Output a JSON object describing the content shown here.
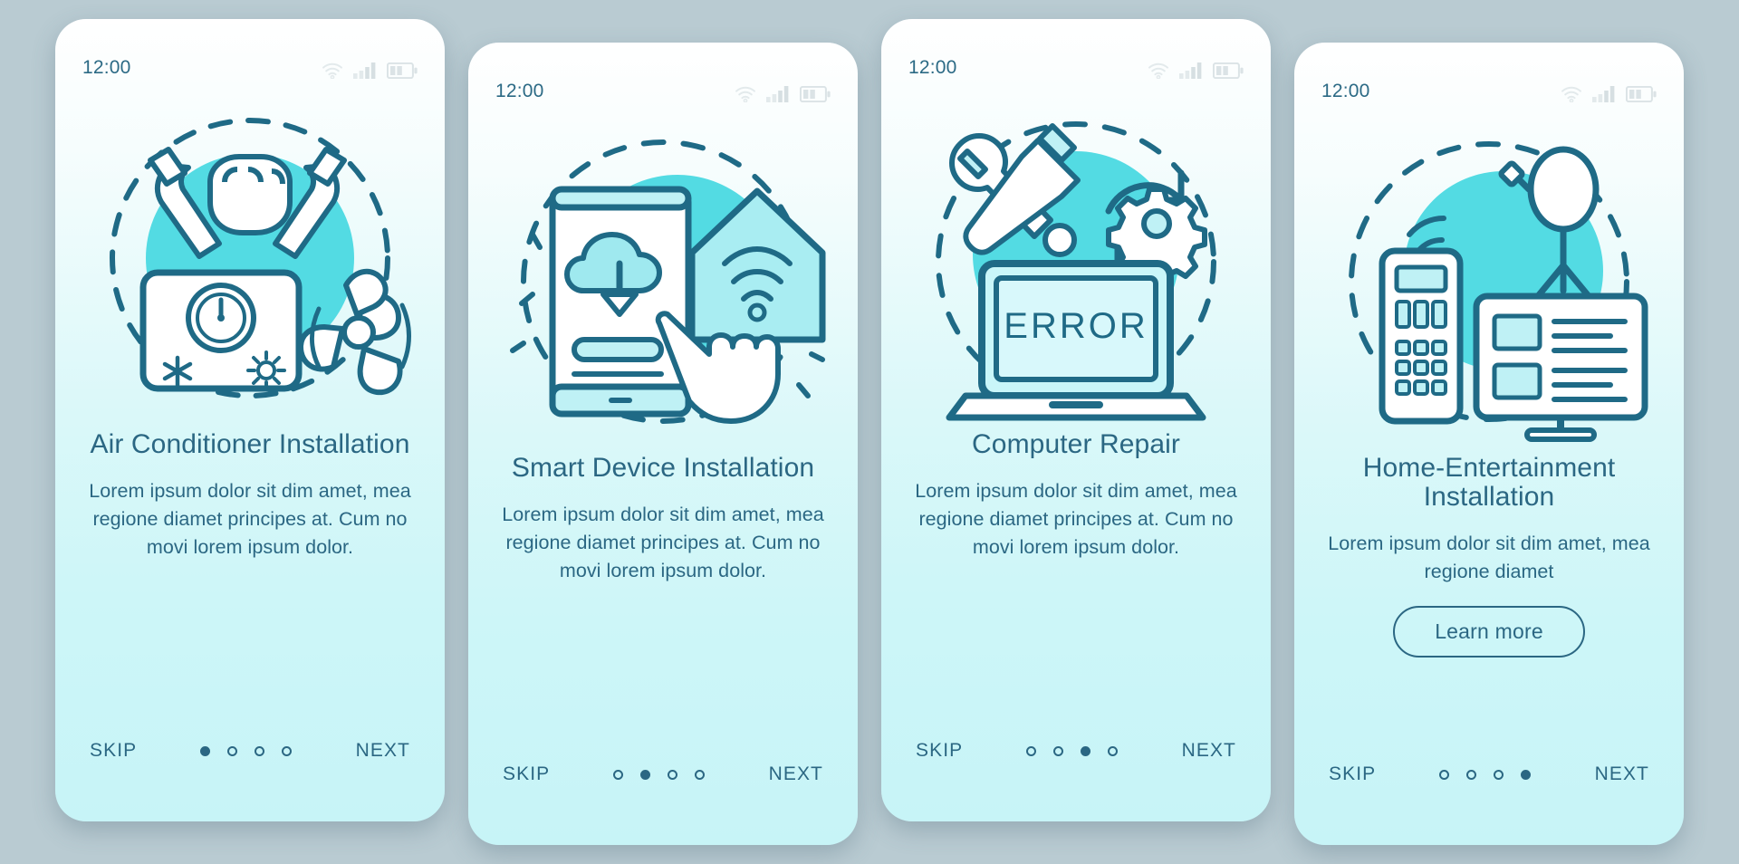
{
  "theme": {
    "page_background": "#b9cbd2",
    "ink": "#2b6783",
    "accent_teal": "#4bd6e0",
    "card_top": "#ffffff",
    "card_bottom": "#c7f4f7"
  },
  "screens": [
    {
      "status": {
        "time": "12:00",
        "wifi_icon": "wifi-icon",
        "signal_icon": "signal-bars-icon",
        "battery_icon": "battery-icon"
      },
      "illustration": "air-conditioner-illustration",
      "title": "Air Conditioner Installation",
      "description": "Lorem ipsum dolor sit dim amet, mea regione diamet principes at. Cum no movi lorem ipsum dolor.",
      "cta": null,
      "skip_label": "SKIP",
      "next_label": "NEXT",
      "dots": 4,
      "active_dot": 0
    },
    {
      "status": {
        "time": "12:00",
        "wifi_icon": "wifi-icon",
        "signal_icon": "signal-bars-icon",
        "battery_icon": "battery-icon"
      },
      "illustration": "smart-device-illustration",
      "title": "Smart Device Installation",
      "description": "Lorem ipsum dolor sit dim amet, mea regione diamet principes at. Cum no movi lorem ipsum dolor.",
      "cta": null,
      "skip_label": "SKIP",
      "next_label": "NEXT",
      "dots": 4,
      "active_dot": 1
    },
    {
      "status": {
        "time": "12:00",
        "wifi_icon": "wifi-icon",
        "signal_icon": "signal-bars-icon",
        "battery_icon": "battery-icon"
      },
      "illustration": "computer-repair-illustration",
      "screen_text": "ERROR",
      "title": "Computer Repair",
      "description": "Lorem ipsum dolor sit dim amet, mea regione diamet principes at. Cum no movi lorem ipsum dolor.",
      "cta": null,
      "skip_label": "SKIP",
      "next_label": "NEXT",
      "dots": 4,
      "active_dot": 2
    },
    {
      "status": {
        "time": "12:00",
        "wifi_icon": "wifi-icon",
        "signal_icon": "signal-bars-icon",
        "battery_icon": "battery-icon"
      },
      "illustration": "home-entertainment-illustration",
      "title": "Home-Entertainment Installation",
      "description": "Lorem ipsum dolor sit dim amet, mea regione diamet",
      "cta": "Learn more",
      "skip_label": "SKIP",
      "next_label": "NEXT",
      "dots": 4,
      "active_dot": 3
    }
  ]
}
